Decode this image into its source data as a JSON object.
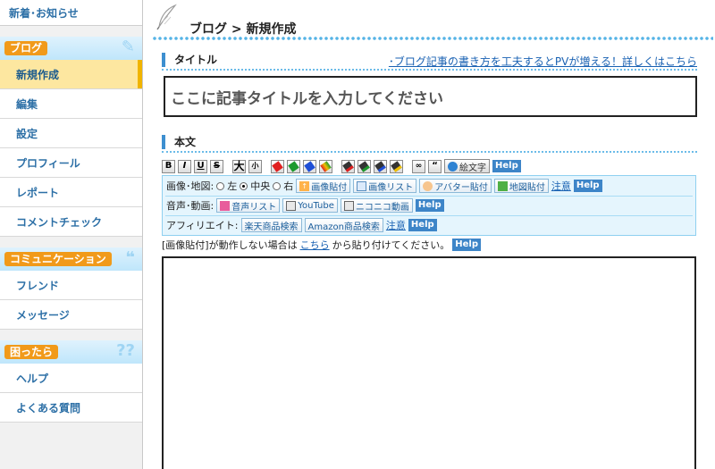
{
  "sidebar": {
    "top_link": "新着･お知らせ",
    "sections": {
      "blog": {
        "heading": "ブログ",
        "items": [
          "新規作成",
          "編集",
          "設定",
          "プロフィール",
          "レポート",
          "コメントチェック"
        ]
      },
      "community": {
        "heading": "コミュニケーション",
        "items": [
          "フレンド",
          "メッセージ"
        ]
      },
      "help": {
        "heading": "困ったら",
        "items": [
          "ヘルプ",
          "よくある質問"
        ]
      }
    },
    "active_item": "新規作成",
    "accent": "#f19a1a"
  },
  "header": {
    "breadcrumb": "ブログ > 新規作成"
  },
  "title_section": {
    "label": "タイトル",
    "hint_link": "･ブログ記事の書き方を工夫するとPVが増える！詳しくはこちら",
    "input_value": "ここに記事タイトルを入力してください"
  },
  "body_section": {
    "label": "本文",
    "format_toolbar": {
      "bold": "B",
      "italic": "I",
      "underline": "U",
      "strike": "S",
      "size_large": "大",
      "size_small": "小",
      "quote": "“",
      "emoji_label": "絵文字",
      "help": "Help"
    },
    "media_rows": {
      "image": {
        "label": "画像･地図:",
        "align_left": "左",
        "align_center": "中央",
        "align_right": "右",
        "selected_align": "中央",
        "paste_image": "画像貼付",
        "image_list": "画像リスト",
        "avatar_paste": "アバター貼付",
        "map_paste": "地図貼付",
        "note": "注意",
        "help": "Help"
      },
      "audio_video": {
        "label": "音声･動画:",
        "audio_list": "音声リスト",
        "youtube": "YouTube",
        "nicovideo": "ニコニコ動画",
        "help": "Help"
      },
      "affiliate": {
        "label": "アフィリエイト:",
        "rakuten": "楽天商品検索",
        "amazon": "Amazon商品検索",
        "note": "注意",
        "help": "Help"
      }
    },
    "paste_note": {
      "before": "[画像貼付]が動作しない場合は",
      "link": "こちら",
      "after": "から貼り付けてください。",
      "help": "Help"
    },
    "textarea_value": ""
  },
  "colors": {
    "link": "#1a62b3",
    "help_badge": "#3d85c8",
    "dot_line": "#6bbbe8"
  }
}
